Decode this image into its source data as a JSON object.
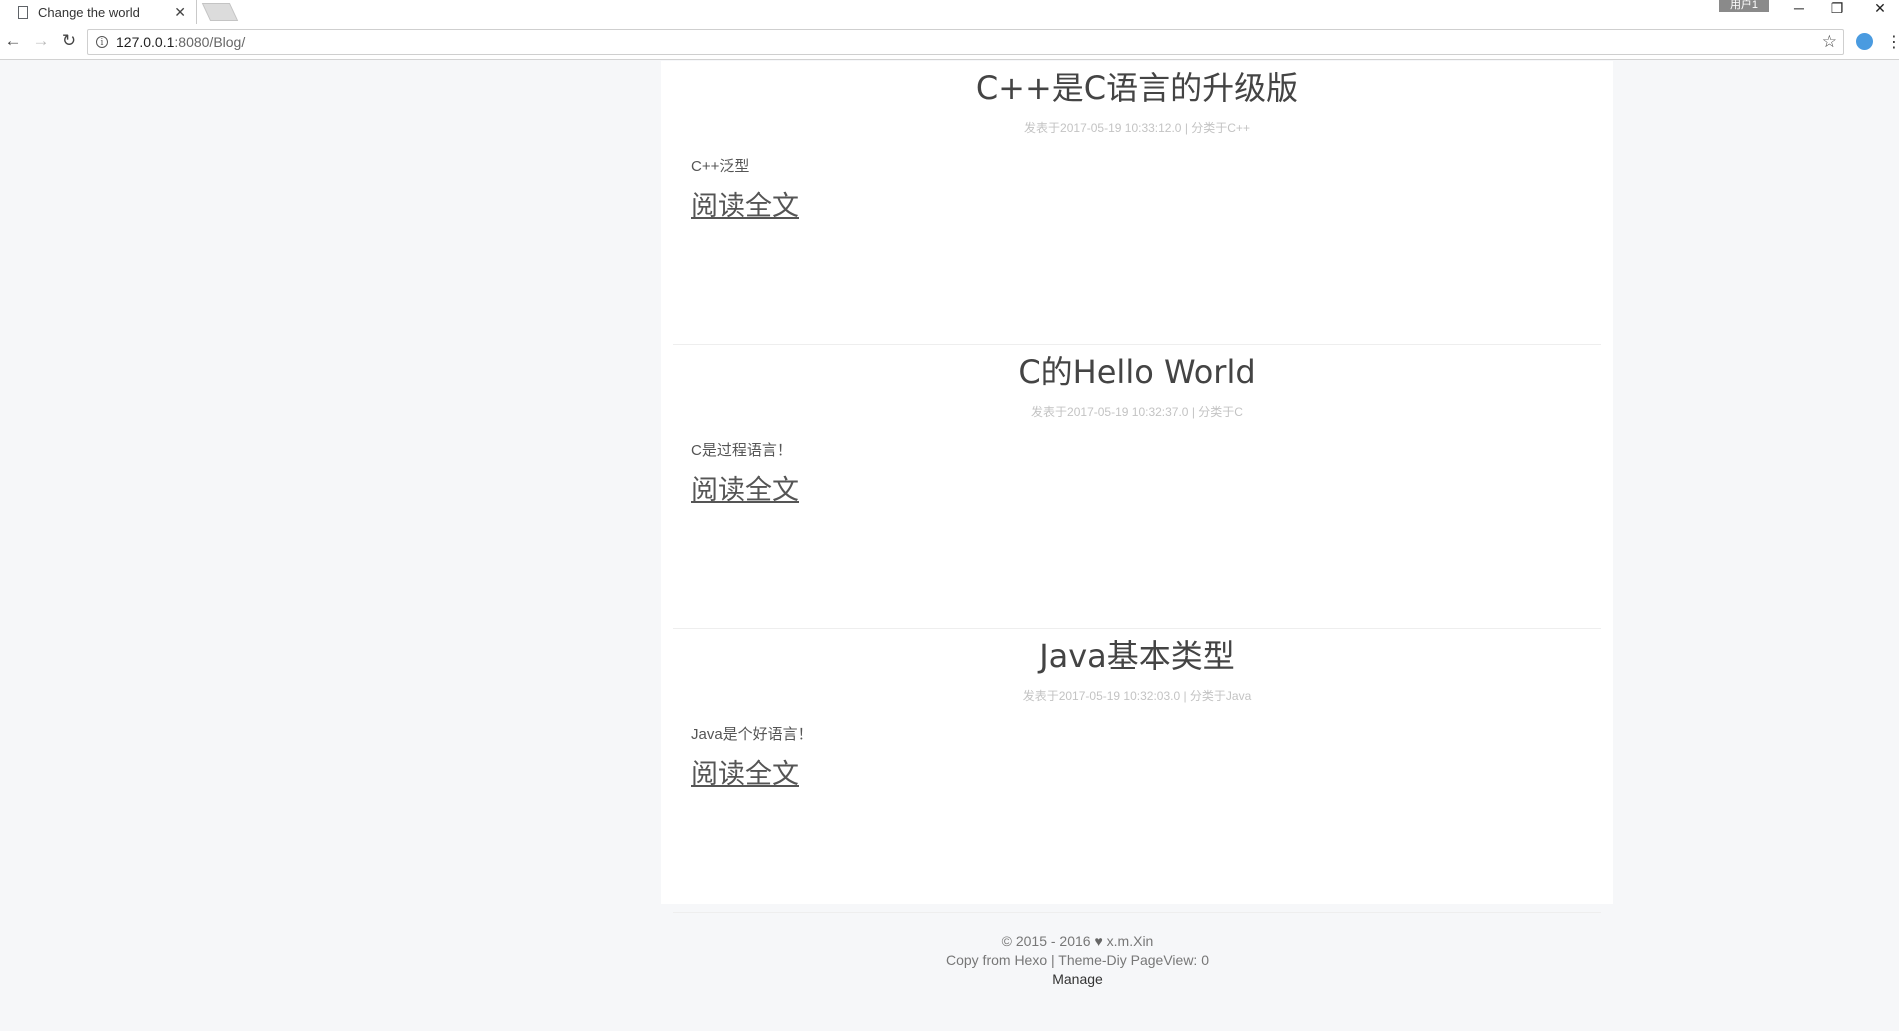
{
  "browser": {
    "tab_title": "Change the world",
    "tab_close": "✕",
    "url_host": "127.0.0.1",
    "url_rest": ":8080/Blog/",
    "user_badge": "用户1",
    "window_controls": {
      "minimize": "─",
      "restore": "❐",
      "close": "✕"
    },
    "nav": {
      "back": "←",
      "forward": "→",
      "reload": "↻"
    },
    "star": "☆",
    "menu": "⋮"
  },
  "posts": [
    {
      "title": "C++是C语言的升级版",
      "meta": "发表于2017-05-19 10:33:12.0 | 分类于C++",
      "excerpt": "C++泛型",
      "read_more": "阅读全文"
    },
    {
      "title": "C的Hello World",
      "meta": "发表于2017-05-19 10:32:37.0 | 分类于C",
      "excerpt": "C是过程语言！",
      "read_more": "阅读全文"
    },
    {
      "title": "Java基本类型",
      "meta": "发表于2017-05-19 10:32:03.0 | 分类于Java",
      "excerpt": "Java是个好语言！",
      "read_more": "阅读全文"
    }
  ],
  "footer": {
    "copyright": "© 2015 - 2016",
    "heart": "♥",
    "author": "x.m.Xin",
    "line2": "Copy from Hexo | Theme-Diy PageView: 0",
    "manage": "Manage"
  },
  "colors": {
    "page_bg": "#f6f7f9",
    "content_bg": "#ffffff",
    "meta_text": "#c3c3c3",
    "ext_icon": "#4a9be0"
  },
  "icons": [
    "document-icon",
    "close-icon",
    "back-icon",
    "forward-icon",
    "reload-icon",
    "info-icon",
    "star-icon",
    "extension-icon",
    "menu-icon",
    "heart-icon"
  ]
}
